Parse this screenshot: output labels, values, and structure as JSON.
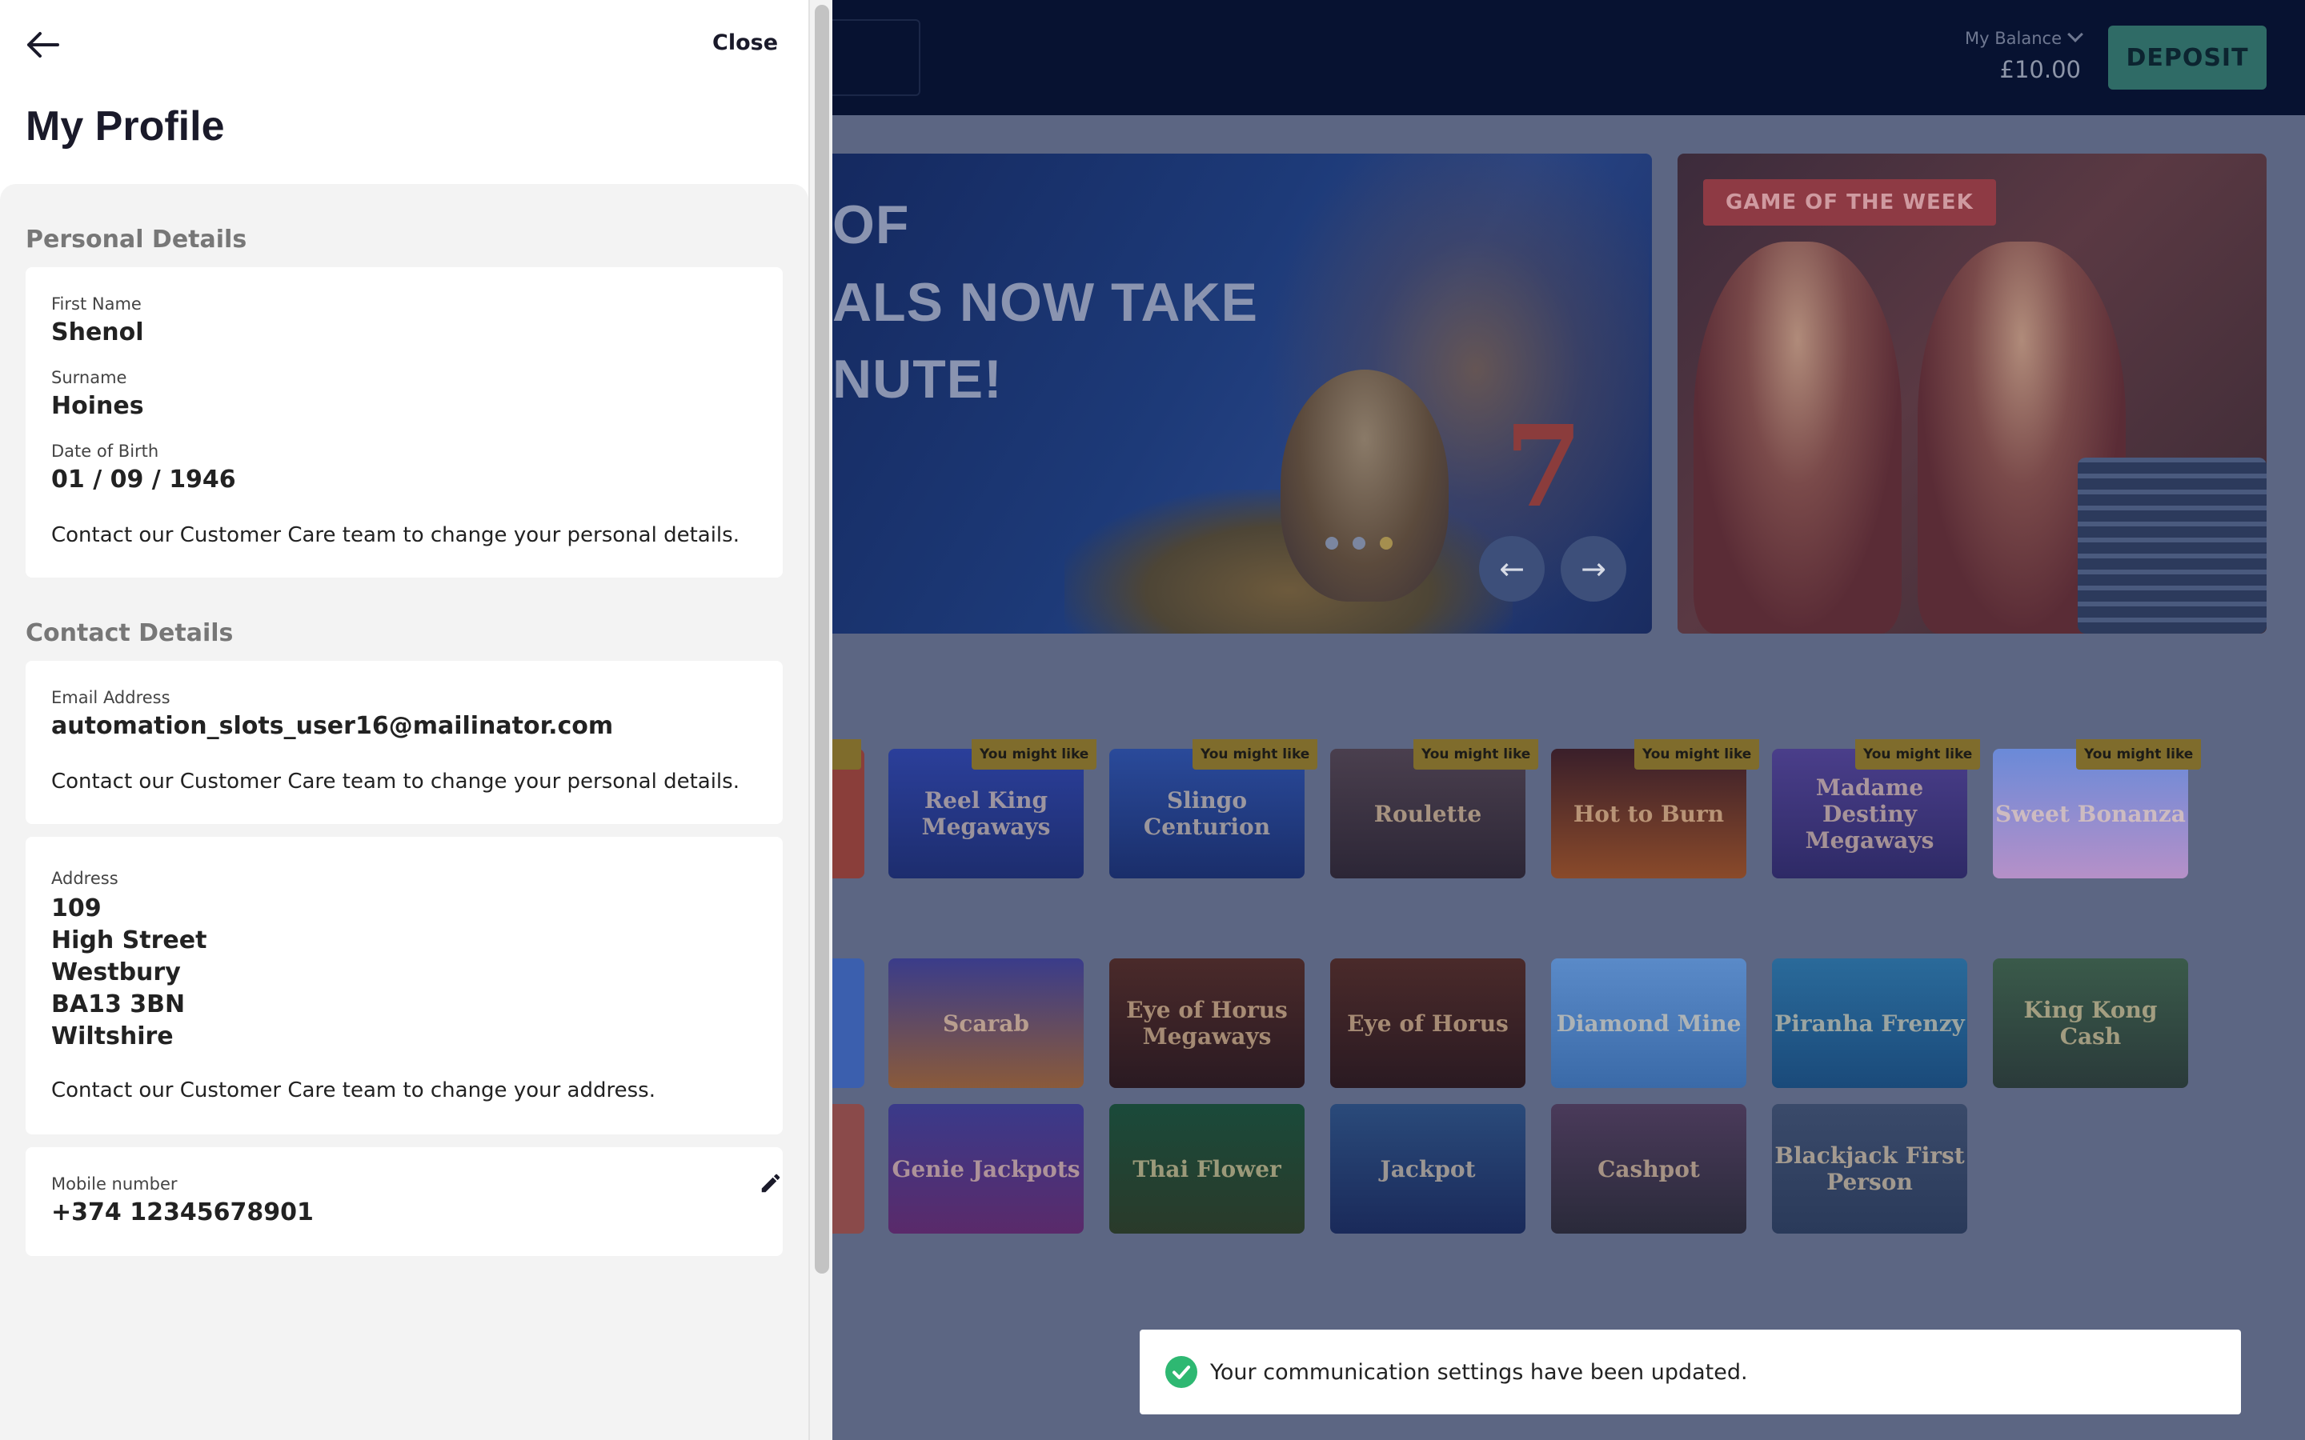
{
  "site": {
    "balance_label": "My Balance",
    "balance_value": "£10.00",
    "deposit_label": "DEPOSIT",
    "hero_text_lines": [
      "OF",
      "ALS NOW TAKE",
      "NUTE!"
    ],
    "game_of_week_label": "GAME OF THE WEEK",
    "recommend_tag": "You might like",
    "row1_games": [
      "Reel King Megaways",
      "Slingo Centurion",
      "Roulette",
      "Hot to Burn",
      "Madame Destiny Megaways",
      "Sweet Bonanza"
    ],
    "row2_games": [
      "Scarab",
      "Eye of Horus Megaways",
      "Eye of Horus",
      "Diamond Mine",
      "Piranha Frenzy",
      "King Kong Cash"
    ],
    "row3_games": [
      "Genie Jackpots",
      "Thai Flower",
      "Jackpot",
      "Cashpot",
      "Blackjack First Person"
    ],
    "colors": {
      "topbar": "#071231",
      "deposit": "#2f6b66",
      "overlay_bg": "#5c6683"
    }
  },
  "panel": {
    "close_label": "Close",
    "title": "My Profile",
    "personal": {
      "section_title": "Personal Details",
      "first_name_label": "First Name",
      "first_name": "Shenol",
      "surname_label": "Surname",
      "surname": "Hoines",
      "dob_label": "Date of Birth",
      "dob": "01 / 09 / 1946",
      "note": "Contact our Customer Care team to change your personal details."
    },
    "contact": {
      "section_title": "Contact Details",
      "email_label": "Email Address",
      "email": "automation_slots_user16@mailinator.com",
      "email_note": "Contact our Customer Care team to change your personal details.",
      "address_label": "Address",
      "address_lines": [
        "109",
        "High Street",
        "Westbury",
        "BA13 3BN",
        "Wiltshire"
      ],
      "address_note": "Contact our Customer Care team to change your address.",
      "mobile_label": "Mobile number",
      "mobile": "+374 12345678901"
    }
  },
  "toast": {
    "message": "Your communication settings have been updated.",
    "icon": "check-circle-icon",
    "color": "#2eb872"
  }
}
